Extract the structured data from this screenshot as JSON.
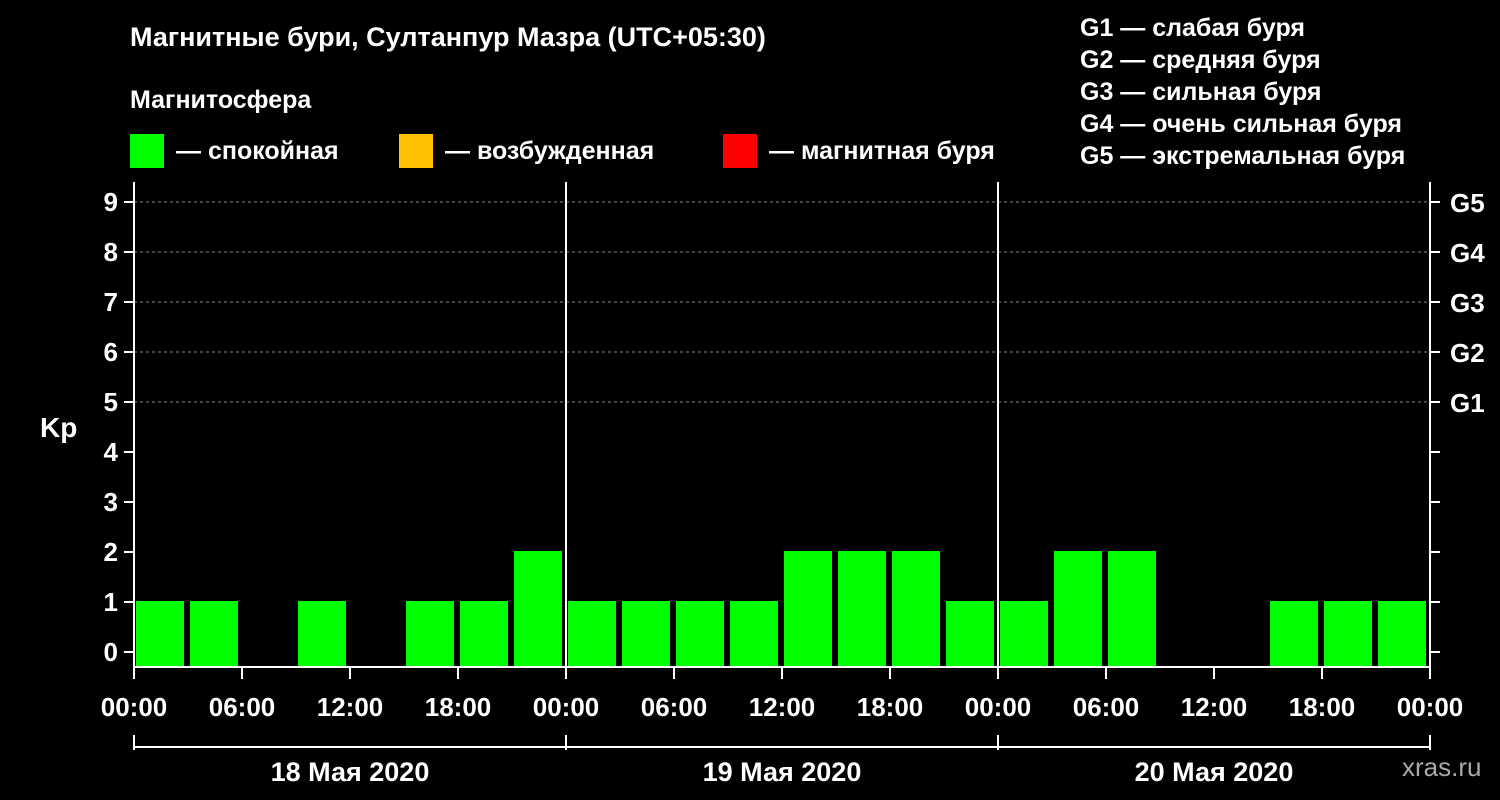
{
  "chart_data": {
    "type": "bar",
    "title": "Магнитные бури, Султанпур Мазра (UTC+05:30)",
    "ylabel": "Kp",
    "ylim": [
      0,
      9
    ],
    "yticks": [
      "0",
      "1",
      "2",
      "3",
      "4",
      "5",
      "6",
      "7",
      "8",
      "9"
    ],
    "right_ticks": [
      {
        "kp": 5,
        "label": "G1"
      },
      {
        "kp": 6,
        "label": "G2"
      },
      {
        "kp": 7,
        "label": "G3"
      },
      {
        "kp": 8,
        "label": "G4"
      },
      {
        "kp": 9,
        "label": "G5"
      }
    ],
    "x_time_labels": [
      "00:00",
      "06:00",
      "12:00",
      "18:00",
      "00:00",
      "06:00",
      "12:00",
      "18:00",
      "00:00",
      "06:00",
      "12:00",
      "18:00",
      "00:00"
    ],
    "dates": [
      "18 Мая 2020",
      "19 Мая 2020",
      "20 Мая 2020"
    ],
    "magnetosphere_label": "Магнитосфера",
    "legend": [
      {
        "label": "— спокойная",
        "color": "#00ff00"
      },
      {
        "label": "— возбужденная",
        "color": "#ffc000"
      },
      {
        "label": "— магнитная буря",
        "color": "#ff0000"
      }
    ],
    "storm_levels": [
      "G1 — слабая буря",
      "G2 — средняя буря",
      "G3 — сильная буря",
      "G4 — очень сильная буря",
      "G5 — экстремальная буря"
    ],
    "grid": true,
    "bar_color": "#00ff00",
    "values": [
      1,
      1,
      0,
      1,
      0,
      1,
      1,
      2,
      1,
      1,
      1,
      1,
      2,
      2,
      2,
      1,
      1,
      2,
      2,
      0,
      0,
      1,
      1,
      1
    ]
  },
  "watermark": "xras.ru"
}
